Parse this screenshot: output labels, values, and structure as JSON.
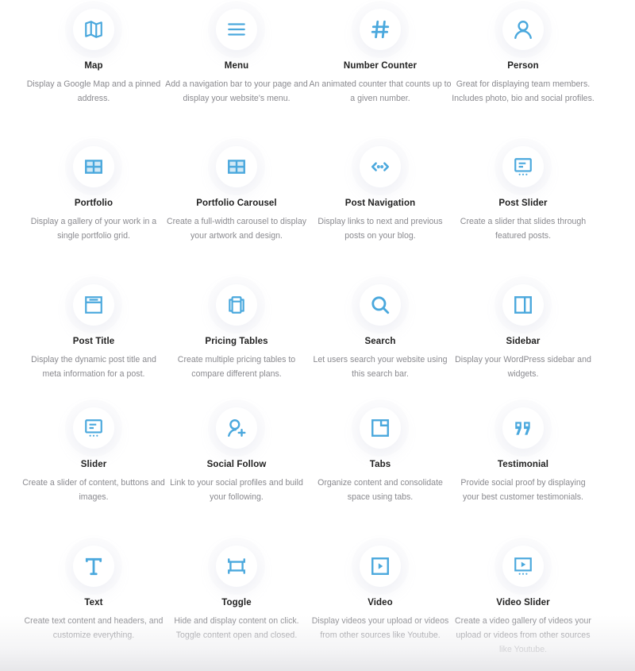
{
  "accent_color": "#4aa8dd",
  "modules": [
    {
      "id": "map",
      "icon": "map-icon",
      "title": "Map",
      "description": "Display a Google Map and a pinned address."
    },
    {
      "id": "menu",
      "icon": "menu-icon",
      "title": "Menu",
      "description": "Add a navigation bar to your page and display your website's menu."
    },
    {
      "id": "number-counter",
      "icon": "hash-icon",
      "title": "Number Counter",
      "description": "An animated counter that counts up to a given number."
    },
    {
      "id": "person",
      "icon": "person-icon",
      "title": "Person",
      "description": "Great for displaying team members. Includes photo, bio and social profiles."
    },
    {
      "id": "portfolio",
      "icon": "grid-icon",
      "title": "Portfolio",
      "description": "Display a gallery of your work in a single portfolio grid."
    },
    {
      "id": "portfolio-carousel",
      "icon": "grid-icon",
      "title": "Portfolio Carousel",
      "description": "Create a full-width carousel to display your artwork and design."
    },
    {
      "id": "post-navigation",
      "icon": "post-navigation-icon",
      "title": "Post Navigation",
      "description": "Display links to next and previous posts on your blog."
    },
    {
      "id": "post-slider",
      "icon": "slider-icon",
      "title": "Post Slider",
      "description": "Create a slider that slides through featured posts."
    },
    {
      "id": "post-title",
      "icon": "post-title-icon",
      "title": "Post Title",
      "description": "Display the dynamic post title and meta information for a post."
    },
    {
      "id": "pricing-tables",
      "icon": "pricing-tables-icon",
      "title": "Pricing Tables",
      "description": "Create multiple pricing tables to compare different plans."
    },
    {
      "id": "search",
      "icon": "search-icon",
      "title": "Search",
      "description": "Let users search your website using this search bar."
    },
    {
      "id": "sidebar",
      "icon": "sidebar-icon",
      "title": "Sidebar",
      "description": "Display your WordPress sidebar and widgets."
    },
    {
      "id": "slider",
      "icon": "slider-icon",
      "title": "Slider",
      "description": "Create a slider of content, buttons and images."
    },
    {
      "id": "social-follow",
      "icon": "add-user-icon",
      "title": "Social Follow",
      "description": "Link to your social profiles and build your following."
    },
    {
      "id": "tabs",
      "icon": "tabs-icon",
      "title": "Tabs",
      "description": "Organize content and consolidate space using tabs."
    },
    {
      "id": "testimonial",
      "icon": "quote-icon",
      "title": "Testimonial",
      "description": "Provide social proof by displaying your best customer testimonials."
    },
    {
      "id": "text",
      "icon": "text-icon",
      "title": "Text",
      "description": "Create text content and headers, and customize everything."
    },
    {
      "id": "toggle",
      "icon": "toggle-icon",
      "title": "Toggle",
      "description": "Hide and display content on click. Toggle content open and closed."
    },
    {
      "id": "video",
      "icon": "video-icon",
      "title": "Video",
      "description": "Display videos your upload or videos from other sources like Youtube."
    },
    {
      "id": "video-slider",
      "icon": "video-slider-icon",
      "title": "Video Slider",
      "description": "Create a video gallery of videos your upload or videos from other sources like Youtube."
    }
  ]
}
